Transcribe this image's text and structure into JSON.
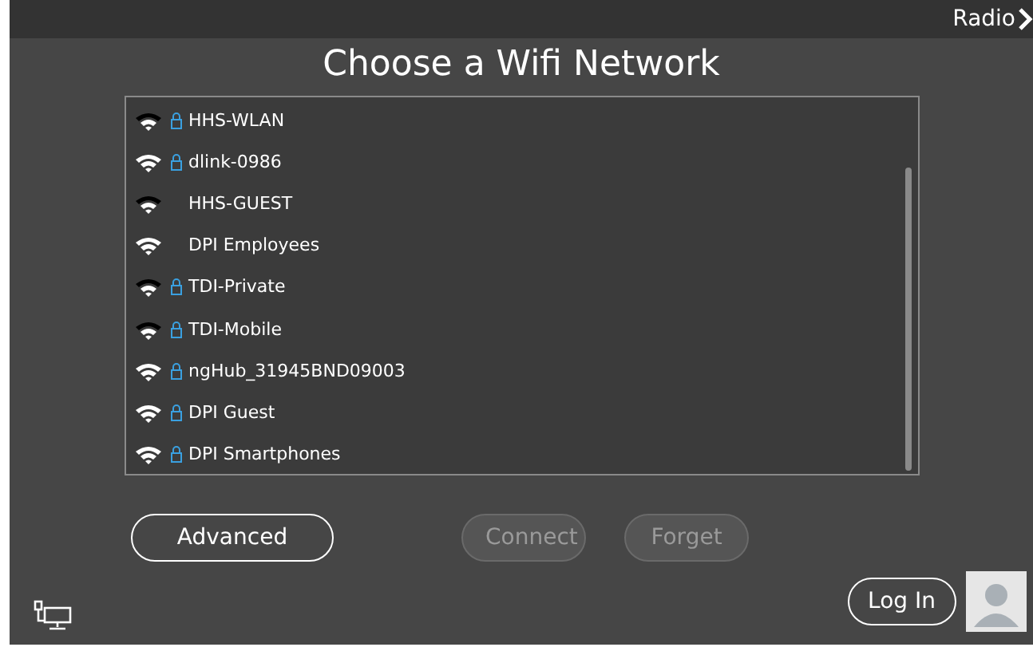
{
  "top_bar": {
    "link": "Radio"
  },
  "title": "Choose a Wifi Network",
  "networks": [
    {
      "name": "HHS-WLAN",
      "weak_signal": true,
      "secured": true
    },
    {
      "name": "dlink-0986",
      "weak_signal": false,
      "secured": true
    },
    {
      "name": "HHS-GUEST",
      "weak_signal": true,
      "secured": false
    },
    {
      "name": "DPI Employees",
      "weak_signal": false,
      "secured": false
    },
    {
      "name": "TDI-Private",
      "weak_signal": true,
      "secured": true
    },
    {
      "name": "TDI-Mobile",
      "weak_signal": true,
      "secured": true
    },
    {
      "name": "ngHub_31945BND09003",
      "weak_signal": false,
      "secured": true
    },
    {
      "name": "DPI Guest",
      "weak_signal": false,
      "secured": true
    },
    {
      "name": "DPI Smartphones",
      "weak_signal": false,
      "secured": true
    }
  ],
  "buttons": [
    {
      "label": "Advanced",
      "disabled": false
    },
    {
      "label": "Connect",
      "disabled": true
    },
    {
      "label": "Forget",
      "disabled": true
    }
  ],
  "login": {
    "label": "Log In"
  }
}
